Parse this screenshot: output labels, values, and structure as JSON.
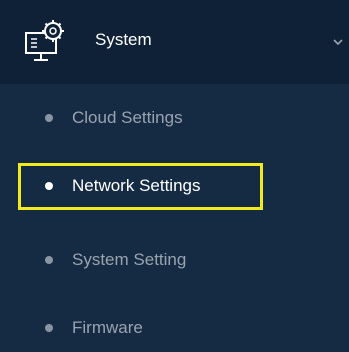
{
  "menu": {
    "header": {
      "label": "System",
      "icon": "system-settings-icon",
      "expand_icon": "chevron-down-icon"
    },
    "items": [
      {
        "label": "Cloud Settings",
        "active": false
      },
      {
        "label": "Network Settings",
        "active": true
      },
      {
        "label": "System Setting",
        "active": false
      },
      {
        "label": "Firmware",
        "active": false
      }
    ],
    "highlight_color": "#f2ea1d",
    "background": "#152b43",
    "header_background": "#0f2136"
  }
}
